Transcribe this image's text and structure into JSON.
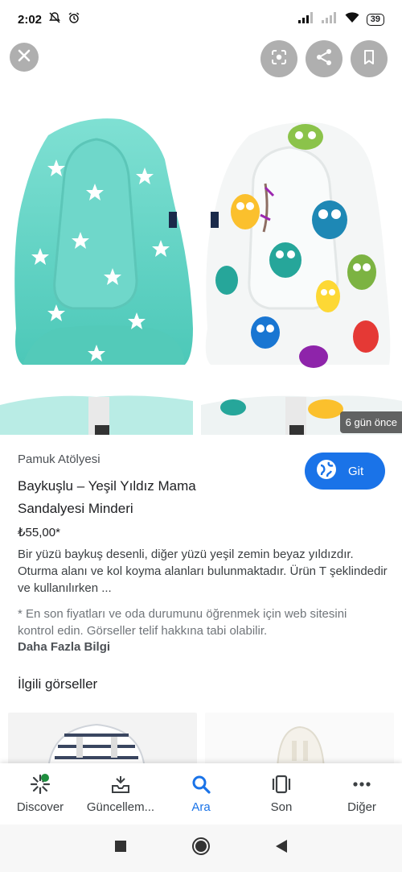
{
  "status_bar": {
    "time": "2:02",
    "battery": "39"
  },
  "image_overlay": {
    "age_badge": "6 gün önce"
  },
  "result": {
    "source": "Pamuk Atölyesi",
    "title": "Baykuşlu – Yeşil Yıldız Mama Sandalyesi Minderi",
    "go_label": "Git",
    "price": "₺55,00*",
    "description": "Bir yüzü baykuş desenli, diğer yüzü yeşil zemin beyaz yıldızdır. Oturma alanı ve kol koyma alanları bulunmaktadır. Ürün T şeklindedir ve kullanılırken ...",
    "note": "* En son fiyatları ve oda durumunu öğrenmek için web sitesini kontrol edin. Görseller telif hakkına tabi olabilir.",
    "more_link": "Daha Fazla Bilgi"
  },
  "related": {
    "heading": "İlgili görseller"
  },
  "bottom_nav": {
    "items": [
      {
        "label": "Discover",
        "icon": "discover-icon"
      },
      {
        "label": "Güncellem...",
        "icon": "updates-icon"
      },
      {
        "label": "Ara",
        "icon": "search-icon"
      },
      {
        "label": "Son",
        "icon": "recent-icon"
      },
      {
        "label": "Diğer",
        "icon": "more-icon"
      }
    ],
    "active": "Ara"
  },
  "colors": {
    "accent": "#1a73e8",
    "mint": "#5fd3c4",
    "owl_pattern_bg": "#f4f6f6"
  }
}
